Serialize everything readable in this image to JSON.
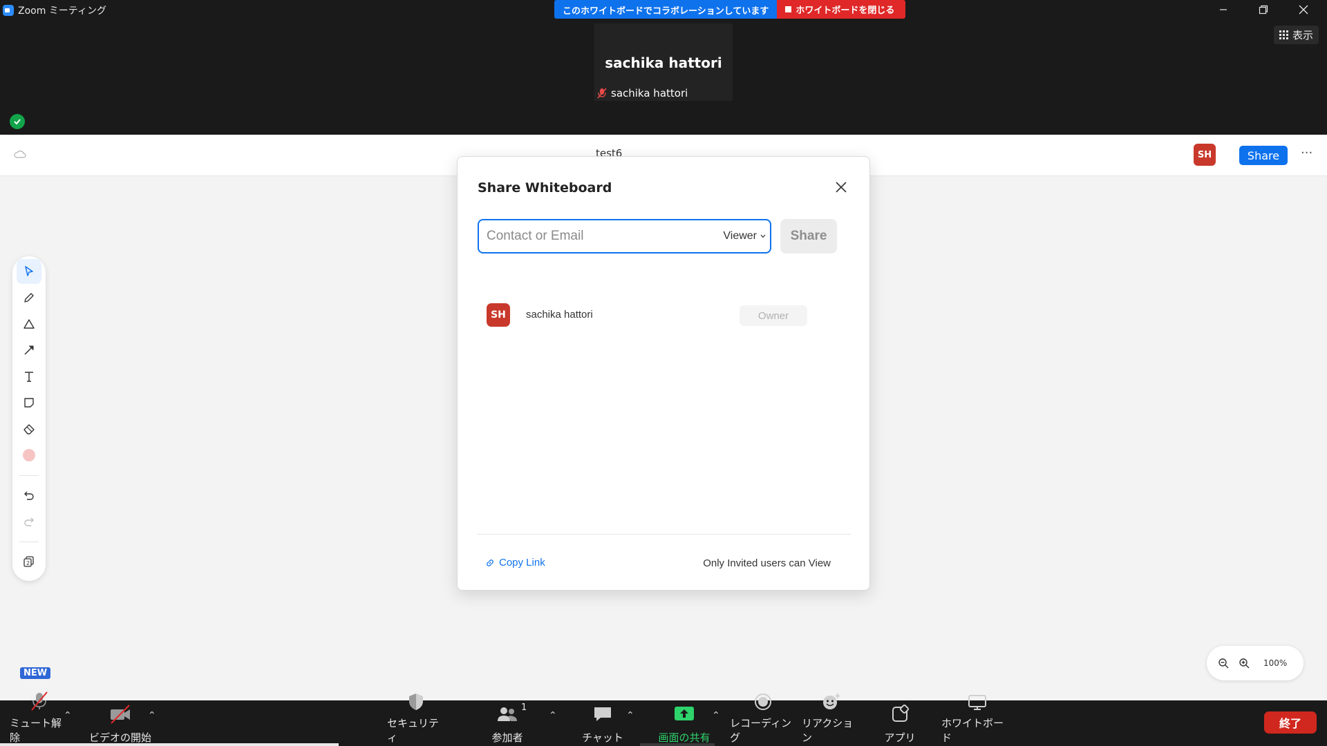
{
  "window": {
    "title": "Zoom ミーティング",
    "collab_banner": "このホワイトボードでコラボレーションしています",
    "close_whiteboard": "ホワイトボードを閉じる"
  },
  "video": {
    "view_button": "表示",
    "participant_name": "sachika hattori",
    "tile_label": "sachika hattori"
  },
  "whiteboard": {
    "title": "test6",
    "avatar_initials": "SH",
    "share_label": "Share",
    "more_label": "···",
    "new_badge": "NEW",
    "zoom_level": "100%",
    "tools": [
      "select-icon",
      "pen-icon",
      "shape-icon",
      "arrow-icon",
      "text-icon",
      "sticky-note-icon",
      "eraser-icon",
      "color-picker-icon",
      "undo-icon",
      "redo-icon",
      "pages-icon"
    ],
    "accent_color": "#0e72ed",
    "selected_color": "#f7c4c4"
  },
  "share_dialog": {
    "title": "Share Whiteboard",
    "input_placeholder": "Contact or Email",
    "role": "Viewer",
    "share_button": "Share",
    "members": [
      {
        "initials": "SH",
        "name": "sachika hattori",
        "role": "Owner"
      }
    ],
    "copy_link": "Copy Link",
    "access_setting": "Only Invited users can View"
  },
  "controls": {
    "unmute": "ミュート解除",
    "start_video": "ビデオの開始",
    "security": "セキュリティ",
    "participants": "参加者",
    "participants_count": "1",
    "chat": "チャット",
    "share_screen": "画面の共有",
    "recording": "レコーディング",
    "reactions": "リアクション",
    "apps": "アプリ",
    "whiteboard": "ホワイトボード",
    "end": "終了",
    "share_color": "#2ed36b",
    "end_color": "#d0281e"
  }
}
